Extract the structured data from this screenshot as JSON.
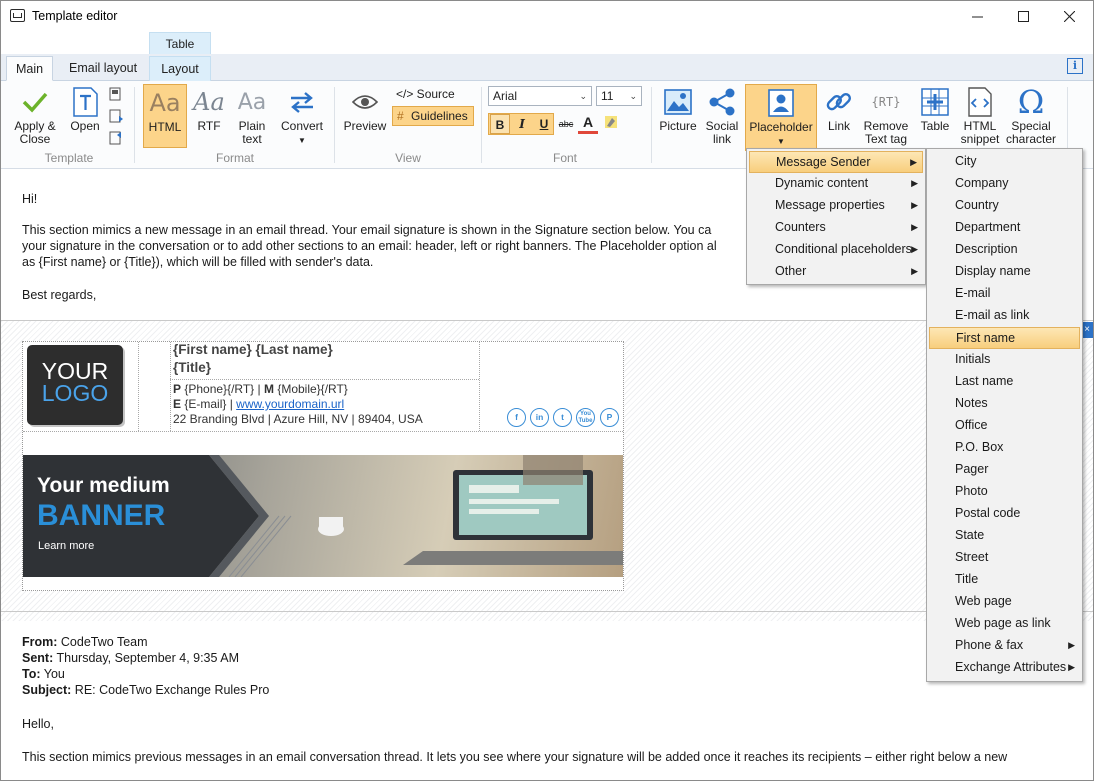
{
  "window": {
    "title": "Template editor"
  },
  "ribbon_tabs": {
    "main": "Main",
    "email_layout": "Email layout",
    "table_context_header": "Table",
    "layout": "Layout"
  },
  "ribbon": {
    "template": {
      "apply_close": "Apply &\nClose",
      "open": "Open",
      "group_label": "Template"
    },
    "format": {
      "html": "HTML",
      "rtf": "RTF",
      "plain_text": "Plain\ntext",
      "convert": "Convert",
      "group_label": "Format",
      "selected": "HTML"
    },
    "view": {
      "preview": "Preview",
      "source": "</> Source",
      "guidelines": "Guidelines",
      "group_label": "View"
    },
    "font": {
      "font_name": "Arial",
      "font_size": "11",
      "group_label": "Font"
    },
    "insert": {
      "picture": "Picture",
      "social_link": "Social\nlink",
      "placeholder": "Placeholder",
      "link": "Link",
      "remove_text_tag": "Remove\nText tag",
      "table": "Table",
      "html_snippet": "HTML\nsnippet",
      "special_character": "Special\ncharacter"
    }
  },
  "editor": {
    "greeting": "Hi!",
    "intro_lines": [
      "This section mimics a new message in an email thread. Your email signature is shown in the Signature section below. You ca",
      "your signature in the conversation or to add other sections to an email: header, left or right banners. The Placeholder option al",
      "as {First name} or {Title}), which will be filled with sender's data."
    ],
    "closing": "Best regards,",
    "signature": {
      "logo_line1": "YOUR",
      "logo_line2": "LOGO",
      "name_line": "{First name} {Last name}",
      "title_line": "{Title}",
      "phone_p": "P",
      "phone_value": " {Phone}{/RT} | ",
      "phone_m": "M",
      "mobile_value": " {Mobile}{/RT}",
      "email_e": "E",
      "email_value": " {E-mail} | ",
      "website": "www.yourdomain.url",
      "address": "22 Branding Blvd | Azure Hill, NV | 89404, USA",
      "social": [
        "f",
        "in",
        "t",
        "You\nTube",
        "P"
      ],
      "banner_line1": "Your medium",
      "banner_line2": "BANNER",
      "banner_cta": "Learn more"
    },
    "reply": {
      "from_label": "From:",
      "from_value": " CodeTwo Team",
      "sent_label": "Sent:",
      "sent_value": " Thursday, September 4, 9:35 AM",
      "to_label": "To:",
      "to_value": " You",
      "subject_label": "Subject:",
      "subject_value": " RE: CodeTwo Exchange Rules Pro",
      "hello": "Hello,",
      "body": "This section mimics previous messages in an email conversation thread. It lets you see where your signature will be added once it reaches its recipients – either right below a new"
    }
  },
  "placeholder_menu": [
    {
      "label": "Message Sender",
      "submenu": true,
      "highlighted": true
    },
    {
      "label": "Dynamic content",
      "submenu": true
    },
    {
      "label": "Message properties",
      "submenu": true
    },
    {
      "label": "Counters",
      "submenu": true
    },
    {
      "label": "Conditional placeholders",
      "submenu": true
    },
    {
      "label": "Other",
      "submenu": true
    }
  ],
  "sender_submenu": [
    {
      "label": "City"
    },
    {
      "label": "Company"
    },
    {
      "label": "Country"
    },
    {
      "label": "Department"
    },
    {
      "label": "Description"
    },
    {
      "label": "Display name"
    },
    {
      "label": "E-mail"
    },
    {
      "label": "E-mail as link"
    },
    {
      "label": "First name",
      "highlighted": true
    },
    {
      "label": "Initials"
    },
    {
      "label": "Last name"
    },
    {
      "label": "Notes"
    },
    {
      "label": "Office"
    },
    {
      "label": "P.O. Box"
    },
    {
      "label": "Pager"
    },
    {
      "label": "Photo"
    },
    {
      "label": "Postal code"
    },
    {
      "label": "State"
    },
    {
      "label": "Street"
    },
    {
      "label": "Title"
    },
    {
      "label": "Web page"
    },
    {
      "label": "Web page as link"
    },
    {
      "label": "Phone & fax",
      "submenu": true
    },
    {
      "label": "Exchange Attributes",
      "submenu": true
    }
  ],
  "colors": {
    "accent": "#2c72c7",
    "selection": "#fcd48a",
    "banner_blue": "#2a8fd8"
  }
}
